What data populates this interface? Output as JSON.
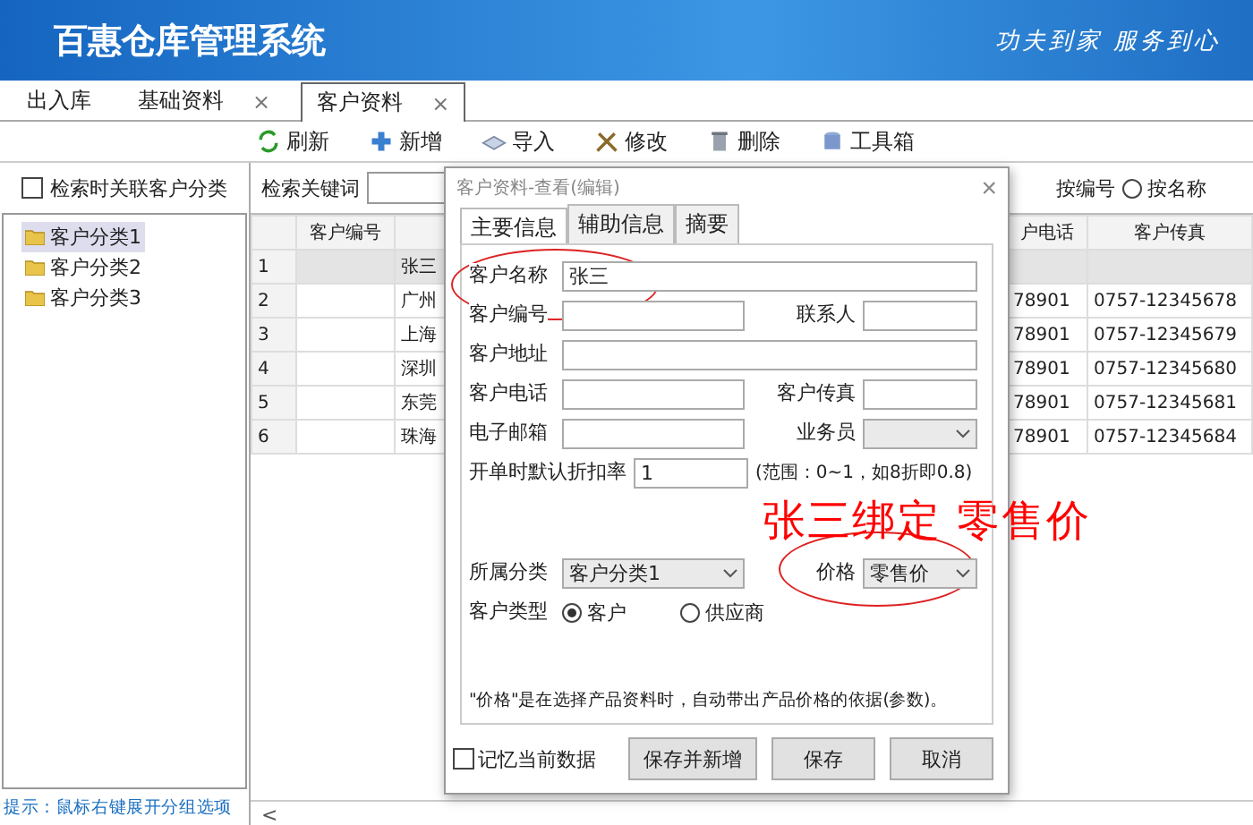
{
  "header": {
    "title": "百惠仓库管理系统",
    "slogan": "功夫到家 服务到心"
  },
  "tabs": [
    {
      "label": "出入库",
      "selected": false
    },
    {
      "label": "基础资料",
      "selected": false,
      "close": "×"
    },
    {
      "label": "客户资料",
      "selected": true,
      "close": "×"
    }
  ],
  "close_glyph": "×",
  "toolbar": [
    {
      "label": "刷新",
      "kind": "refresh"
    },
    {
      "label": "新增",
      "kind": "add"
    },
    {
      "label": "导入",
      "kind": "import"
    },
    {
      "label": "修改",
      "kind": "edit"
    },
    {
      "label": "删除",
      "kind": "delete"
    },
    {
      "label": "工具箱",
      "kind": "toolbox"
    }
  ],
  "sidebar": {
    "filter": {
      "label": "检索时关联客户分类",
      "checked": false
    },
    "tree": [
      {
        "label": "客户分类1",
        "selected": true
      },
      {
        "label": "客户分类2",
        "selected": false
      },
      {
        "label": "客户分类3",
        "selected": false
      }
    ],
    "hint": "提示：鼠标右键展开分组选项"
  },
  "search": {
    "label": "检索关键词",
    "by_code_label": "按编号",
    "by_name": {
      "label": "按名称",
      "selected": false
    }
  },
  "table": {
    "columns": [
      "客户编号",
      "户电话",
      "客户传真"
    ],
    "rows": [
      {
        "index": "1",
        "name": "张三",
        "phone": "",
        "fax": "",
        "selected": true
      },
      {
        "index": "2",
        "name": "广州",
        "phone": "78901",
        "fax": "0757-12345678",
        "selected": false
      },
      {
        "index": "3",
        "name": "上海",
        "phone": "78901",
        "fax": "0757-12345679",
        "selected": false
      },
      {
        "index": "4",
        "name": "深圳",
        "phone": "78901",
        "fax": "0757-12345680",
        "selected": false
      },
      {
        "index": "5",
        "name": "东莞",
        "phone": "78901",
        "fax": "0757-12345681",
        "selected": false
      },
      {
        "index": "6",
        "name": "珠海",
        "phone": "78901",
        "fax": "0757-12345684",
        "selected": false
      }
    ],
    "scroll_glyph": "<"
  },
  "dialog": {
    "title": "客户资料-查看(编辑)",
    "tabs": [
      {
        "label": "主要信息",
        "selected": true
      },
      {
        "label": "辅助信息",
        "selected": false
      },
      {
        "label": "摘要",
        "selected": false
      }
    ],
    "rows": [
      [
        {
          "label": "客户名称",
          "kind": "text",
          "value": "张三"
        }
      ],
      [
        {
          "label": "客户编号",
          "kind": "text"
        },
        {
          "label": "联系人",
          "kind": "text"
        }
      ],
      [
        {
          "label": "客户地址",
          "kind": "text"
        }
      ],
      [
        {
          "label": "客户电话",
          "kind": "text"
        },
        {
          "label": "客户传真",
          "kind": "text"
        }
      ],
      [
        {
          "label": "电子邮箱",
          "kind": "text"
        },
        {
          "label": "业务员",
          "kind": "select"
        }
      ],
      [
        {
          "label": "开单时默认折扣率",
          "kind": "text",
          "value": "1",
          "hint": "(范围：0~1，如8折即0.8)"
        }
      ],
      [
        {
          "label": "所属分类",
          "kind": "select",
          "value": "客户分类1"
        },
        {
          "label": "价格",
          "kind": "select",
          "value": "零售价"
        }
      ]
    ],
    "customer_type": {
      "label": "客户类型",
      "options": [
        {
          "label": "客户",
          "selected": true
        },
        {
          "label": "供应商",
          "selected": false
        }
      ]
    },
    "note": "\"价格\"是在选择产品资料时，自动带出产品价格的依据(参数)。",
    "remember": {
      "label": "记忆当前数据",
      "checked": false
    },
    "buttons": [
      "保存并新增",
      "保存",
      "取消"
    ]
  },
  "annotation": {
    "text": "张三绑定 零售价"
  }
}
